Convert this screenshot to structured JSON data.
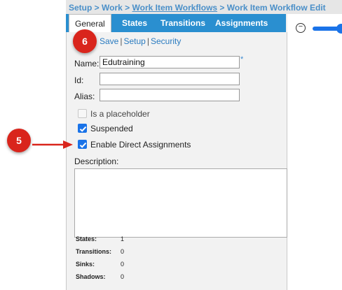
{
  "breadcrumb": {
    "setup": "Setup",
    "sep1": " > ",
    "work": "Work",
    "sep2": " > ",
    "workflows": "Work Item Workflows",
    "sep3": " > ",
    "current": "Work Item Workflow Edit"
  },
  "tabs": [
    {
      "label": "General",
      "active": true
    },
    {
      "label": "States",
      "active": false
    },
    {
      "label": "Transitions",
      "active": false
    },
    {
      "label": "Assignments",
      "active": false
    }
  ],
  "actions": {
    "save": "Save",
    "setup": "Setup",
    "security": "Security",
    "separator": "|"
  },
  "form": {
    "name_label": "Name:",
    "name_value": "Edutraining",
    "required_marker": "*",
    "id_label": "Id:",
    "id_value": "",
    "alias_label": "Alias:",
    "alias_value": ""
  },
  "checkboxes": [
    {
      "label": "Is a placeholder",
      "checked": false,
      "disabled": true
    },
    {
      "label": "Suspended",
      "checked": true,
      "disabled": false
    },
    {
      "label": "Enable Direct Assignments",
      "checked": true,
      "disabled": false
    }
  ],
  "description": {
    "label": "Description:",
    "value": ""
  },
  "stats": [
    {
      "label": "States:",
      "value": "1"
    },
    {
      "label": "Transitions:",
      "value": "0"
    },
    {
      "label": "Sinks:",
      "value": "0"
    },
    {
      "label": "Shadows:",
      "value": "0"
    }
  ],
  "annotations": {
    "badge_5": "5",
    "badge_6": "6",
    "badge_color": "#d9251c",
    "arrow_color": "#d9251c"
  },
  "colors": {
    "tab_bar": "#2a8fd0",
    "link": "#2a7bc0",
    "checkbox": "#1a73e8"
  },
  "zoom": {
    "minus_symbol": "−"
  }
}
